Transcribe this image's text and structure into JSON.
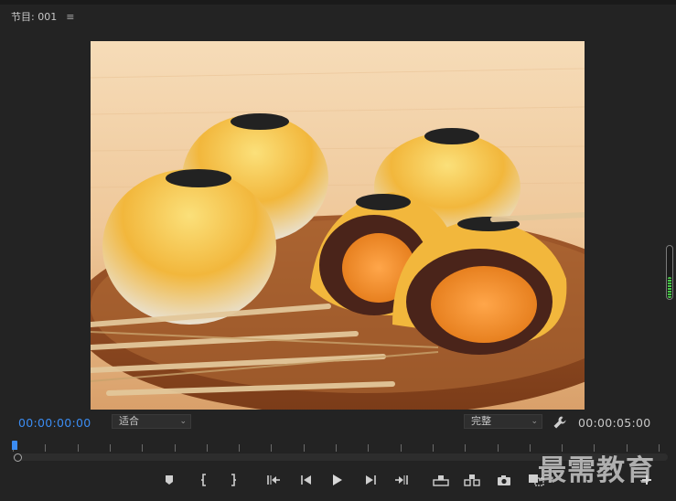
{
  "panel": {
    "title": "节目: 001",
    "menu_icon": "hamburger-menu-icon"
  },
  "timecodes": {
    "current": "00:00:00:00",
    "duration": "00:00:05:00"
  },
  "fit_select": {
    "value": "适合"
  },
  "quality_select": {
    "value": "完整"
  },
  "colors": {
    "accent": "#3b8cf2",
    "background": "#232323",
    "meter_green": "#46c846"
  },
  "audio_meter_level": 0.4,
  "transport_buttons": [
    {
      "name": "add-marker",
      "icon": "marker-icon"
    },
    {
      "name": "mark-in",
      "icon": "mark-in-icon"
    },
    {
      "name": "mark-out",
      "icon": "mark-out-icon"
    },
    {
      "name": "go-to-in",
      "icon": "go-to-in-icon"
    },
    {
      "name": "step-back",
      "icon": "step-back-icon"
    },
    {
      "name": "play",
      "icon": "play-icon"
    },
    {
      "name": "step-forward",
      "icon": "step-forward-icon"
    },
    {
      "name": "go-to-out",
      "icon": "go-to-out-icon"
    },
    {
      "name": "lift",
      "icon": "lift-icon"
    },
    {
      "name": "extract",
      "icon": "extract-icon"
    },
    {
      "name": "export-frame",
      "icon": "camera-icon"
    },
    {
      "name": "comparison-view",
      "icon": "comparison-view-icon"
    },
    {
      "name": "button-editor",
      "icon": "plus-icon"
    }
  ],
  "watermark": "最需教育"
}
